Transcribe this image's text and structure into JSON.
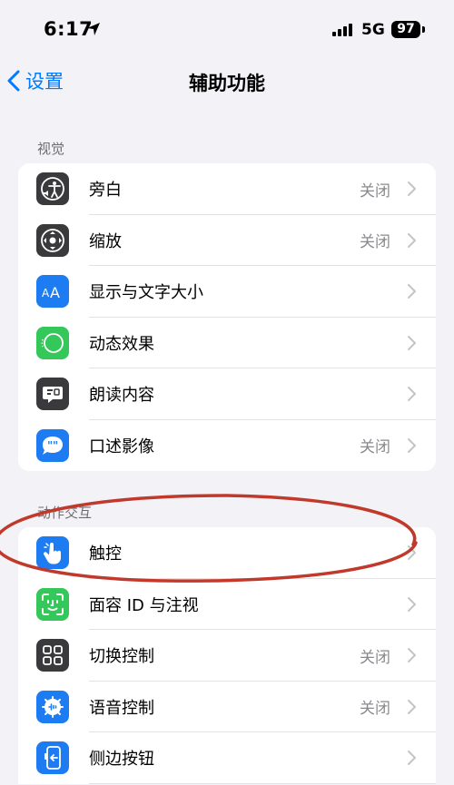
{
  "status_bar": {
    "time": "6:17",
    "network": "5G",
    "battery": "97"
  },
  "nav": {
    "back_label": "设置",
    "title": "辅助功能"
  },
  "sections": [
    {
      "header": "视觉",
      "items": [
        {
          "label": "旁白",
          "value": "关闭",
          "icon": "voiceover-icon",
          "icon_color": "#3a3a3c"
        },
        {
          "label": "缩放",
          "value": "关闭",
          "icon": "zoom-icon",
          "icon_color": "#3a3a3c"
        },
        {
          "label": "显示与文字大小",
          "value": "",
          "icon": "text-size-icon",
          "icon_color": "#1e7cf2"
        },
        {
          "label": "动态效果",
          "value": "",
          "icon": "motion-icon",
          "icon_color": "#34c759"
        },
        {
          "label": "朗读内容",
          "value": "",
          "icon": "spoken-content-icon",
          "icon_color": "#3a3a3c"
        },
        {
          "label": "口述影像",
          "value": "关闭",
          "icon": "audio-description-icon",
          "icon_color": "#1e7cf2"
        }
      ]
    },
    {
      "header": "动作交互",
      "items": [
        {
          "label": "触控",
          "value": "",
          "icon": "touch-hand-icon",
          "icon_color": "#1e7cf2"
        },
        {
          "label": "面容 ID 与注视",
          "value": "",
          "icon": "face-id-icon",
          "icon_color": "#34c759"
        },
        {
          "label": "切换控制",
          "value": "关闭",
          "icon": "switch-control-icon",
          "icon_color": "#3a3a3c"
        },
        {
          "label": "语音控制",
          "value": "关闭",
          "icon": "voice-control-icon",
          "icon_color": "#1e7cf2"
        },
        {
          "label": "侧边按钮",
          "value": "",
          "icon": "side-button-icon",
          "icon_color": "#1e7cf2"
        }
      ]
    }
  ],
  "colors": {
    "accent": "#007aff",
    "annotation": "#c0392b",
    "background": "#f2f2f7"
  }
}
